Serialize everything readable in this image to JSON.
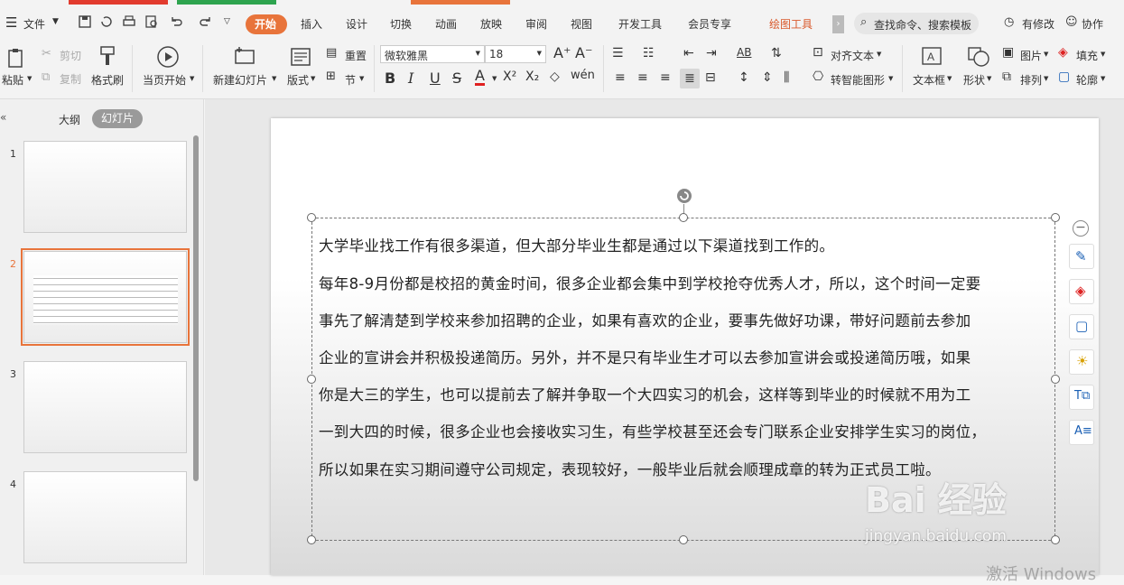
{
  "menubar": {
    "menu_label": "文件",
    "tabs": [
      "开始",
      "插入",
      "设计",
      "切换",
      "动画",
      "放映",
      "审阅",
      "视图",
      "开发工具",
      "会员专享",
      "绘图工具"
    ],
    "active_tab": "开始",
    "search_placeholder": "查找命令、搜索模板",
    "has_changes": "有修改",
    "collaborate": "协作"
  },
  "ribbon": {
    "paste": "粘贴",
    "cut": "剪切",
    "copy": "复制",
    "format_painter": "格式刷",
    "from_current": "当页开始",
    "new_slide": "新建幻灯片",
    "layout": "版式",
    "reset": "重置",
    "section": "节",
    "font_name": "微软雅黑",
    "font_size": "18",
    "align_text": "对齐文本",
    "smartart": "转智能图形",
    "textbox": "文本框",
    "shape": "形状",
    "picture": "图片",
    "arrange": "排列",
    "fill": "填充",
    "outline": "轮廓"
  },
  "leftpane": {
    "tab_outline": "大纲",
    "tab_slides": "幻灯片",
    "slide_numbers": [
      "1",
      "2",
      "3",
      "4"
    ]
  },
  "slide": {
    "paragraphs": [
      "大学毕业找工作有很多渠道，但大部分毕业生都是通过以下渠道找到工作的。",
      "每年8-9月份都是校招的黄金时间，很多企业都会集中到学校抢夺优秀人才，所以，这个时间一定要",
      "事先了解清楚到学校来参加招聘的企业，如果有喜欢的企业，要事先做好功课，带好问题前去参加",
      "企业的宣讲会并积极投递简历。另外，并不是只有毕业生才可以去参加宣讲会或投递简历哦，如果",
      "你是大三的学生，也可以提前去了解并争取一个大四实习的机会，这样等到毕业的时候就不用为工",
      "一到大四的时候，很多企业也会接收实习生，有些学校甚至还会专门联系企业安排学生实习的岗位，",
      "所以如果在实习期间遵守公司规定，表现较好，一般毕业后就会顺理成章的转为正式员工啦。"
    ]
  },
  "watermark": {
    "brand": "Bai 经验",
    "url": "jingyan.baidu.com",
    "activate": "激活 Windows"
  },
  "colors": {
    "accent": "#e8743b",
    "ribbon_bg": "#f3f3f3",
    "drawing_tools": "#d9582b"
  }
}
